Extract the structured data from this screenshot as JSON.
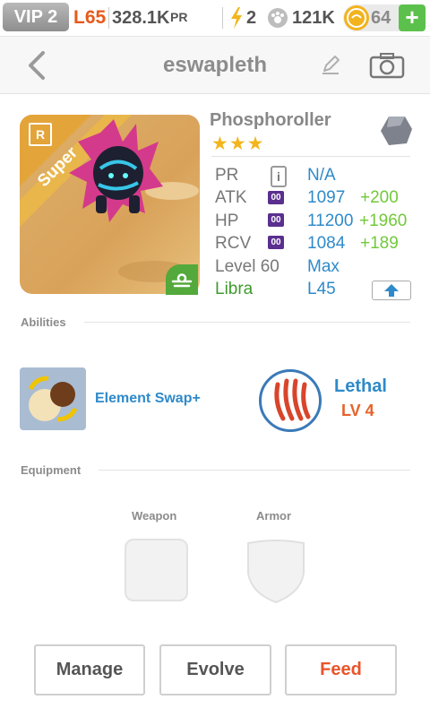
{
  "status_bar": {
    "vip": "VIP 2",
    "level": "L65",
    "power_rating": "328.1K",
    "power_rating_unit": "PR",
    "energy": "2",
    "paw_count": "121K",
    "coins": "64",
    "plus": "+"
  },
  "nav": {
    "title": "eswapleth"
  },
  "monster": {
    "name": "Phosphoroller",
    "stars": "★★★",
    "rarity_badge": "R",
    "tier_ribbon": "Super",
    "star_count": 3
  },
  "stats": {
    "pr_label": "PR",
    "pr_value": "N/A",
    "info_icon": "i",
    "atk_label": "ATK",
    "atk_value": "1097",
    "atk_bonus": "+200",
    "hp_label": "HP",
    "hp_value": "11200",
    "hp_bonus": "+1960",
    "rcv_label": "RCV",
    "rcv_value": "1084",
    "rcv_bonus": "+189",
    "gem_badge": "00",
    "level_label": "Level 60",
    "level_value": "Max",
    "sign_label": "Libra",
    "sign_value": "L45"
  },
  "abilities": {
    "section_title": "Abilities",
    "items": [
      {
        "label": "Element Swap+"
      },
      {
        "name": "Lethal",
        "level": "LV 4"
      }
    ]
  },
  "equipment": {
    "section_title": "Equipment",
    "weapon_label": "Weapon",
    "armor_label": "Armor"
  },
  "actions": {
    "manage": "Manage",
    "evolve": "Evolve",
    "feed": "Feed"
  },
  "colors": {
    "accent_blue": "#2f8ac9",
    "bonus_green": "#72c93a",
    "level_orange": "#e65a1c",
    "feed_orange": "#e8552a"
  }
}
